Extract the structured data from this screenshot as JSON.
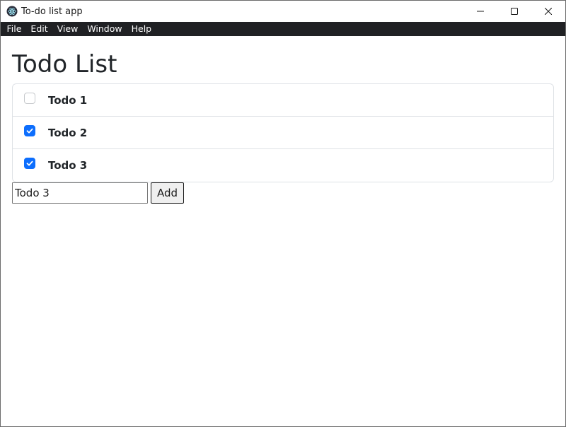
{
  "window": {
    "title": "To-do list app",
    "icon": "electron-atom-icon",
    "controls": [
      "minimize-icon",
      "maximize-icon",
      "close-icon"
    ]
  },
  "menubar": {
    "items": [
      "File",
      "Edit",
      "View",
      "Window",
      "Help"
    ]
  },
  "page": {
    "title": "Todo List"
  },
  "todos": [
    {
      "label": "Todo 1",
      "checked": false
    },
    {
      "label": "Todo 2",
      "checked": true
    },
    {
      "label": "Todo 3",
      "checked": true
    }
  ],
  "add_form": {
    "input_value": "Todo 3",
    "button_label": "Add"
  },
  "colors": {
    "menubar_bg": "#202124",
    "checkbox_checked": "#0d6efd",
    "list_border": "#dee2e6"
  }
}
